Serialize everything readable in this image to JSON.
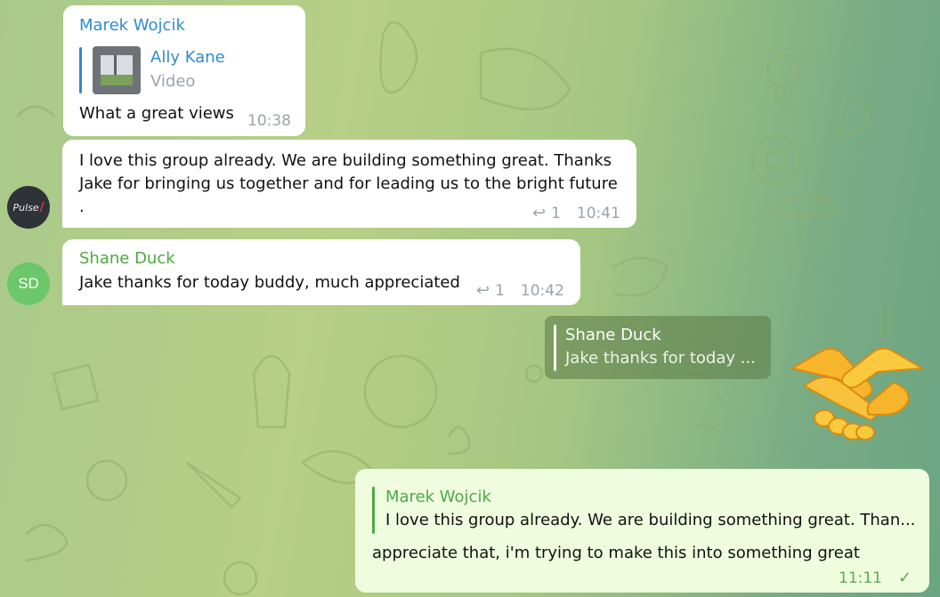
{
  "messages": [
    {
      "sender": "Marek Wojcik",
      "forward": {
        "from": "Ally Kane",
        "type": "Video"
      },
      "text": "What a great views",
      "time": "10:38"
    },
    {
      "avatar_text": "Pulse",
      "text_line1": "I love this group already. We are building something great. Thanks",
      "text_line2": "Jake for bringing us together and for leading us to the bright future",
      "text_line3": ".",
      "reply_count": "1",
      "time": "10:41"
    },
    {
      "avatar_initials": "SD",
      "sender": "Shane Duck",
      "text": "Jake thanks for today buddy, much appreciated",
      "reply_count": "1",
      "time": "10:42"
    }
  ],
  "sticker_reply": {
    "quote_name": "Shane Duck",
    "quote_text": "Jake thanks for today ...",
    "sticker": "handshake"
  },
  "outgoing": {
    "quote_name": "Marek Wojcik",
    "quote_text": "I love this group already. We are building something great. Than...",
    "text": "appreciate that, i'm trying to make this into something great",
    "time": "11:11",
    "status": "✓"
  },
  "colors": {
    "marek": "#2e8bd0",
    "shane": "#4caa3c",
    "outgoing_bg": "#effdde",
    "outgoing_accent": "#4ea84a",
    "sd_avatar": "#6bc769"
  }
}
